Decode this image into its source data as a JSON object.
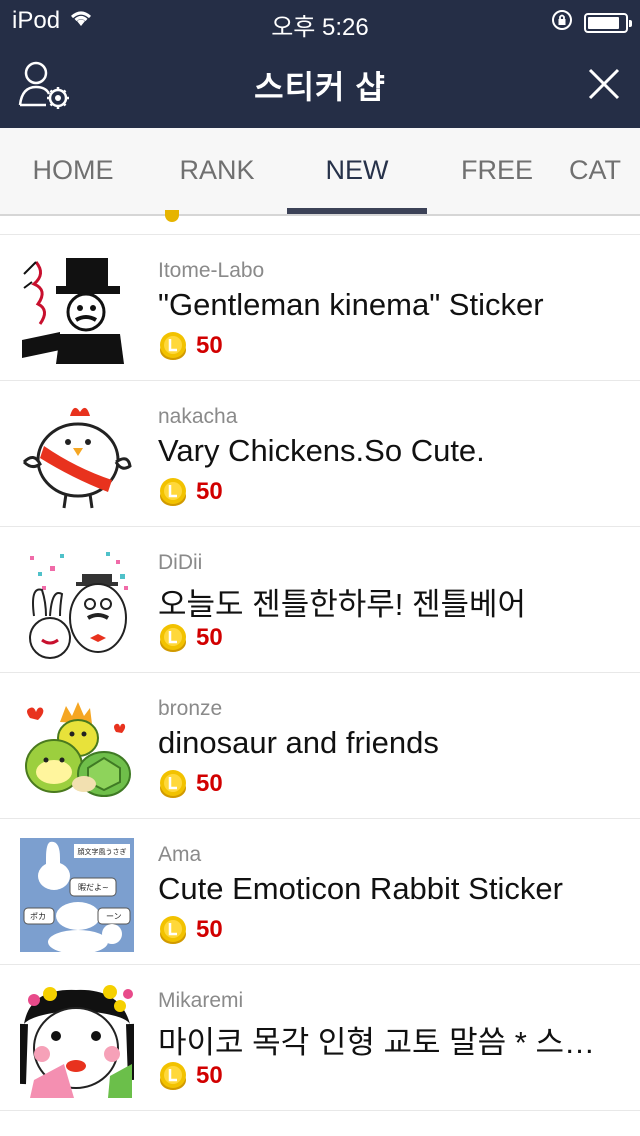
{
  "status_bar": {
    "device": "iPod",
    "time": "오후 5:26",
    "battery_level": 0.85
  },
  "header": {
    "title": "스티커 샵"
  },
  "tabs": [
    {
      "label": "HOME"
    },
    {
      "label": "RANK"
    },
    {
      "label": "NEW",
      "active": true
    },
    {
      "label": "FREE"
    },
    {
      "label": "CAT"
    }
  ],
  "items": [
    {
      "author": "Itome-Labo",
      "title": "\"Gentleman kinema\" Sticker",
      "price": "50"
    },
    {
      "author": "nakacha",
      "title": "Vary Chickens.So Cute.",
      "price": "50"
    },
    {
      "author": "DiDii",
      "title": "오늘도 젠틀한하루! 젠틀베어",
      "price": "50"
    },
    {
      "author": "bronze",
      "title": "dinosaur and friends",
      "price": "50"
    },
    {
      "author": "Ama",
      "title": "Cute Emoticon Rabbit Sticker",
      "price": "50",
      "thumb_text": [
        "顔文字風うさぎ",
        "暇だよ~",
        "ポカ",
        "ーン"
      ]
    },
    {
      "author": "Mikaremi",
      "title": "마이코 목각 인형 교토 말씀 * 스티커",
      "price": "50"
    }
  ],
  "colors": {
    "header_bg": "#252e46",
    "price": "#d10000",
    "coin": "#e6b400",
    "tab_active_underline": "#3c4257"
  }
}
